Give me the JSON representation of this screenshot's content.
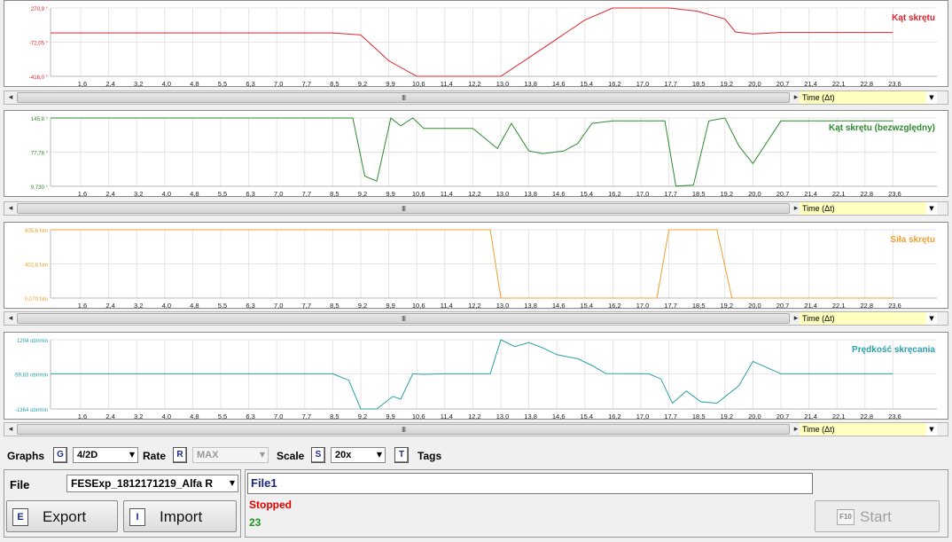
{
  "time_ticks": [
    "1,6",
    "2,4",
    "3,2",
    "4,0",
    "4,8",
    "5,5",
    "6,3",
    "7,0",
    "7,7",
    "8,5",
    "9,2",
    "9,9",
    "10,6",
    "11,4",
    "12,2",
    "13,0",
    "13,8",
    "14,6",
    "15,4",
    "16,2",
    "17,0",
    "17,7",
    "18,5",
    "19,2",
    "20,0",
    "20,7",
    "21,4",
    "22,1",
    "22,8",
    "23,6"
  ],
  "time_axis_label": "Time (Δt)",
  "scroll_grip": "III",
  "charts": [
    {
      "title": "Kąt skrętu",
      "color": "#e0242c",
      "ytick_labels": [
        "270,9 °",
        "-72,05 °",
        "-416,0 °"
      ],
      "ylim": [
        -416.0,
        270.9
      ],
      "ytick_values": [
        270.9,
        -72.05,
        -416.0
      ],
      "x": [
        0.5,
        8.5,
        9.2,
        9.9,
        10.6,
        11.4,
        12.2,
        13.0,
        13.8,
        14.6,
        15.4,
        16.2,
        17.0,
        17.7,
        18.5,
        19.2,
        19.5,
        20.0,
        20.7,
        21.4,
        22.1,
        22.8,
        23.6
      ],
      "y": [
        20,
        20,
        0,
        -260,
        -416,
        -416,
        -416,
        -416,
        -230,
        -40,
        150,
        270.9,
        270.9,
        270.9,
        240,
        160,
        30,
        10,
        25,
        25,
        25,
        25,
        25,
        25
      ]
    },
    {
      "title": "Kąt skrętu (bezwzględny)",
      "color": "#2e8b2e",
      "ytick_labels": [
        "145,8 °",
        "77,78 °",
        "9,730 °"
      ],
      "ylim": [
        9.73,
        145.8
      ],
      "ytick_values": [
        145.8,
        77.78,
        9.73
      ],
      "x": [
        0.5,
        8.5,
        9.0,
        9.3,
        9.6,
        9.95,
        10.2,
        10.5,
        10.8,
        11.4,
        12.2,
        12.9,
        13.3,
        13.8,
        14.2,
        14.8,
        15.2,
        15.6,
        16.2,
        17.2,
        17.6,
        17.9,
        18.4,
        18.8,
        19.2,
        19.6,
        20.0,
        20.7,
        21.4,
        22.1,
        22.8,
        23.6
      ],
      "y": [
        150,
        150,
        150,
        30,
        20,
        160,
        130,
        160,
        125,
        125,
        125,
        85,
        135,
        80,
        75,
        80,
        95,
        135,
        140,
        140,
        140,
        10,
        12,
        140,
        160,
        90,
        55,
        140,
        140,
        140,
        140,
        140,
        140
      ]
    },
    {
      "title": "Siła skrętu",
      "color": "#f0a030",
      "ytick_labels": [
        "805,6 Nm",
        "402,8 Nm",
        "0,070 Nm"
      ],
      "ylim": [
        0.07,
        805.6
      ],
      "ytick_values": [
        805.6,
        402.8,
        0.07
      ],
      "x": [
        0.5,
        12.7,
        13.0,
        17.4,
        17.7,
        19.0,
        19.4,
        23.6
      ],
      "y": [
        805.6,
        805.6,
        0.07,
        0.07,
        805.6,
        805.6,
        0.07,
        0.07
      ]
    },
    {
      "title": "Prędkość skręcania",
      "color": "#2aa0a8",
      "ytick_labels": [
        "1204 obr/min",
        "-59,83 obr/min",
        "-1364 obr/min"
      ],
      "ylim": [
        -1364,
        1204
      ],
      "ytick_values": [
        1204,
        -59.83,
        -1364
      ],
      "x": [
        0.5,
        8.5,
        8.9,
        9.2,
        9.6,
        10.0,
        10.2,
        10.5,
        10.8,
        11.4,
        12.2,
        12.7,
        13.0,
        13.4,
        13.8,
        14.2,
        14.6,
        15.2,
        15.6,
        16.0,
        17.2,
        17.5,
        17.8,
        18.2,
        18.6,
        19.0,
        19.6,
        20.0,
        20.7,
        21.4,
        22.1,
        22.8,
        23.6
      ],
      "y": [
        -59.83,
        -59.83,
        -300,
        -1364,
        -1364,
        -900,
        -1000,
        -59.83,
        -80,
        -59.83,
        -59.83,
        -59.83,
        1204,
        950,
        1100,
        900,
        650,
        500,
        250,
        -50,
        -59.83,
        -250,
        -1150,
        -700,
        -1100,
        -1150,
        -500,
        400,
        -59.83,
        -59.83,
        -59.83,
        -59.83,
        -59.83,
        -59.83
      ]
    }
  ],
  "controls": {
    "graphs_label": "Graphs",
    "graphs_key": "G",
    "graphs_value": "4/2D",
    "rate_label": "Rate",
    "rate_key": "R",
    "rate_value": "MAX",
    "scale_label": "Scale",
    "scale_key": "S",
    "scale_value": "20x",
    "tags_key": "T",
    "tags_label": "Tags"
  },
  "file_panel": {
    "file_label": "File",
    "file_value": "FESExp_1812171219_Alfa R",
    "export_key": "E",
    "export_label": "Export",
    "import_key": "I",
    "import_label": "Import"
  },
  "status_panel": {
    "file_name": "File1",
    "status": "Stopped",
    "count": "23",
    "start_key": "F10",
    "start_label": "Start"
  }
}
